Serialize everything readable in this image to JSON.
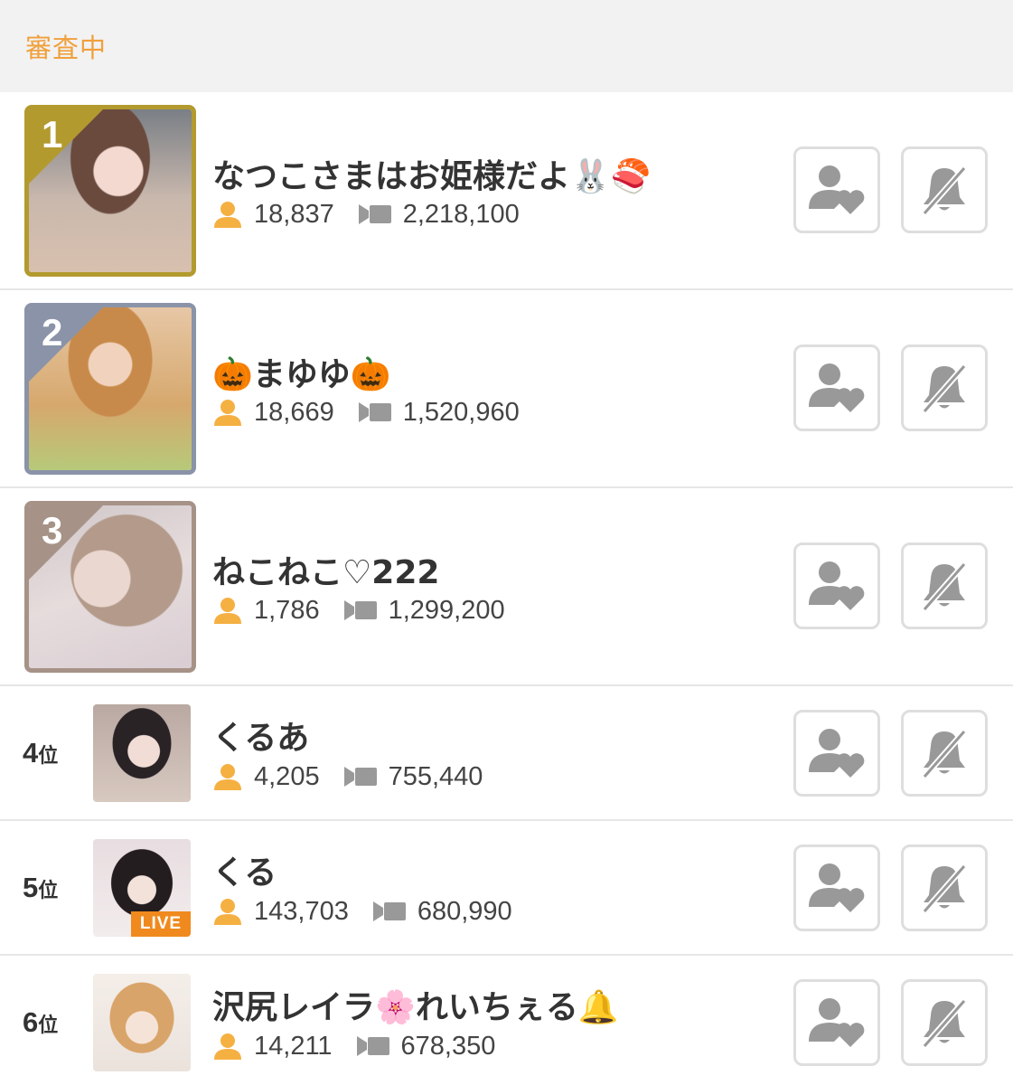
{
  "header": {
    "status": "審査中"
  },
  "colors": {
    "gold": "#b39a2e",
    "silver": "#8a93a8",
    "bronze": "#a69287",
    "accent": "#f0a03c",
    "live": "#f08a1e"
  },
  "icons": {
    "follower": "person-icon",
    "views": "video-camera-icon",
    "follow": "follow-heart-icon",
    "notify": "bell-off-icon"
  },
  "rows": [
    {
      "rank": "1",
      "name": "なつこさまはお姫様だよ🐰🍣",
      "followers": "18,837",
      "views": "2,218,100"
    },
    {
      "rank": "2",
      "name": "🎃まゆゆ🎃",
      "followers": "18,669",
      "views": "1,520,960"
    },
    {
      "rank": "3",
      "name": "ねこねこ♡222",
      "followers": "1,786",
      "views": "1,299,200"
    },
    {
      "rank": "4",
      "rank_suffix": "位",
      "name": "くるあ",
      "followers": "4,205",
      "views": "755,440"
    },
    {
      "rank": "5",
      "rank_suffix": "位",
      "name": "くる",
      "followers": "143,703",
      "views": "680,990",
      "live": "LIVE"
    },
    {
      "rank": "6",
      "rank_suffix": "位",
      "name": "沢尻レイラ🌸れいちぇる🔔",
      "followers": "14,211",
      "views": "678,350"
    }
  ]
}
